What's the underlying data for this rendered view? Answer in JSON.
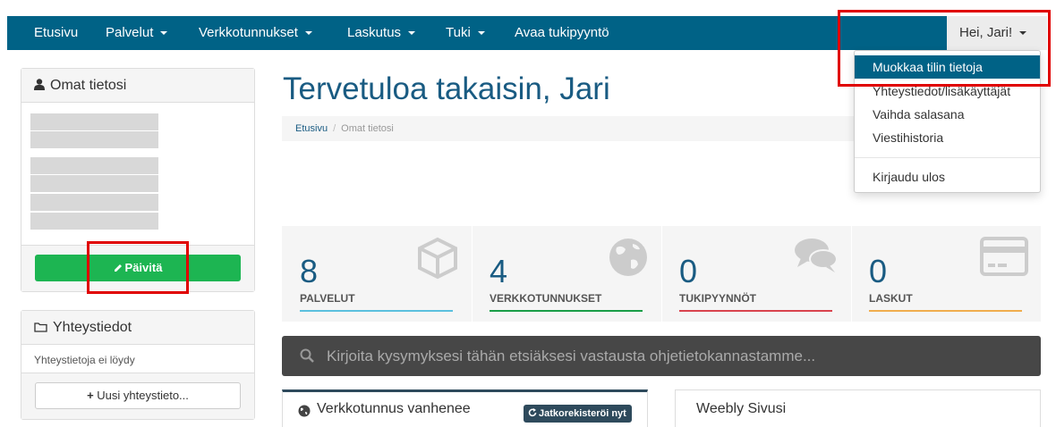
{
  "nav": {
    "items": [
      "Etusivu",
      "Palvelut",
      "Verkkotunnukset",
      "Laskutus",
      "Tuki",
      "Avaa tukipyyntö"
    ],
    "user": "Hei, Jari!"
  },
  "dropdown": {
    "items": [
      "Muokkaa tilin tietoja",
      "Yhteystiedot/lisäkäyttäjät",
      "Vaihda salasana",
      "Viestihistoria"
    ],
    "logout": "Kirjaudu ulos"
  },
  "profile_panel": {
    "title": "Omat tietosi",
    "update_button": "Päivitä"
  },
  "contacts_panel": {
    "title": "Yhteystiedot",
    "empty_text": "Yhteystietoja ei löydy",
    "new_button": "Uusi yhteystieto..."
  },
  "main": {
    "title": "Tervetuloa takaisin, Jari",
    "breadcrumb": {
      "home": "Etusivu",
      "current": "Omat tietosi"
    }
  },
  "tiles": [
    {
      "number": "8",
      "label": "PALVELUT",
      "color": "#5bc0de",
      "icon": "cube-icon"
    },
    {
      "number": "4",
      "label": "VERKKOTUNNUKSET",
      "color": "#1a9e48",
      "icon": "globe-icon"
    },
    {
      "number": "0",
      "label": "TUKIPYYNNÖT",
      "color": "#d9434e",
      "icon": "comments-icon"
    },
    {
      "number": "0",
      "label": "LASKUT",
      "color": "#f0ad4e",
      "icon": "credit-card-icon"
    }
  ],
  "search": {
    "placeholder": "Kirjoita kysymyksesi tähän etsiäksesi vastausta ohjetietokannastamme..."
  },
  "domain_panel": {
    "title": "Verkkotunnus vanhenee",
    "renew_button": "Jatkorekisteröi nyt"
  },
  "weebly_panel": {
    "title": "Weebly Sivusi"
  },
  "colors": {
    "navbar": "#006286",
    "accent": "#195b82",
    "green": "#1db552",
    "highlight": "#e00000"
  }
}
